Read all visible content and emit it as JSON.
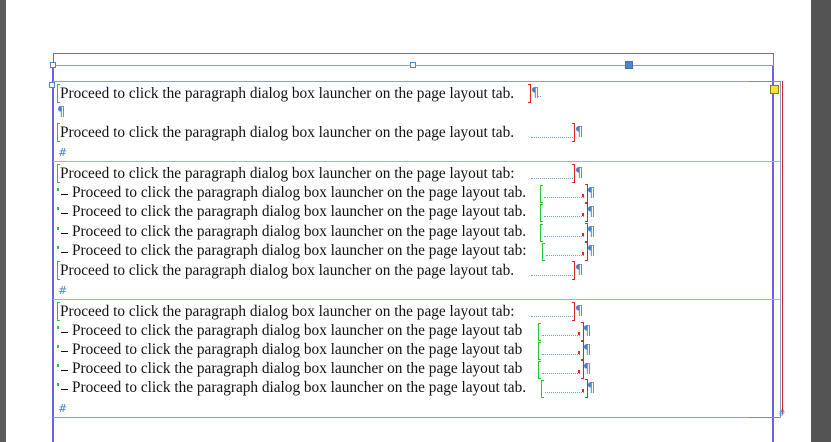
{
  "document": {
    "cells": [
      {
        "paragraphs": [
          {
            "text": "Proceed to click the paragraph dialog box launcher on the page layout tab.",
            "end_mark": "¶"
          },
          {
            "text": "",
            "end_mark": "¶"
          },
          {
            "text": "Proceed to click the paragraph dialog box launcher on the page layout tab.",
            "end_mark": "¶"
          }
        ],
        "end_of_story_mark": "#"
      },
      {
        "paragraphs": [
          {
            "text": "Proceed to click the paragraph dialog box launcher on the page layout tab:",
            "end_mark": "¶"
          },
          {
            "text": "Proceed to click the paragraph dialog box launcher on the page layout tab.",
            "bullet": "-",
            "end_mark": "¶"
          },
          {
            "text": "Proceed to click the paragraph dialog box launcher on the page layout tab.",
            "bullet": "-",
            "end_mark": "¶"
          },
          {
            "text": "Proceed to click the paragraph dialog box launcher on the page layout tab.",
            "bullet": "-",
            "end_mark": "¶"
          },
          {
            "text": "Proceed to click the paragraph dialog box launcher on the page layout tab:",
            "bullet": "-",
            "end_mark": "¶"
          },
          {
            "text": "Proceed to click the paragraph dialog box launcher on the page layout tab.",
            "end_mark": "¶"
          }
        ],
        "end_of_story_mark": "#"
      },
      {
        "paragraphs": [
          {
            "text": "Proceed to click the paragraph dialog box launcher on the page layout tab:",
            "end_mark": "¶"
          },
          {
            "text": "Proceed to click the paragraph dialog box launcher on the page layout tab",
            "bullet": "-",
            "end_mark": "¶"
          },
          {
            "text": "Proceed to click the paragraph dialog box launcher on the page layout tab",
            "bullet": "-",
            "end_mark": "¶"
          },
          {
            "text": "Proceed to click the paragraph dialog box launcher on the page layout tab",
            "bullet": "-",
            "end_mark": "¶"
          },
          {
            "text": "Proceed to click the paragraph dialog box launcher on the page layout tab.",
            "bullet": "-",
            "end_mark": "¶"
          }
        ],
        "end_of_story_mark": "#"
      }
    ]
  },
  "colors": {
    "pasteboard": "#5c5c5c",
    "page": "#ffffff",
    "margin_guide": "#c040d0",
    "column_guide": "#6a5ff0",
    "frame_edge": "#7aa5d8",
    "selection_handle": "#4f86c9",
    "out_port": "#f2e23a",
    "paragraph_bracket_open": "#27c43a",
    "paragraph_bracket_close": "#e02222",
    "hidden_characters": "#4a7fd0"
  },
  "icons": {
    "selection_handles": "square-handle",
    "text_frame_out_port": "out-port-icon",
    "paragraph_mark": "pilcrow-icon",
    "end_of_story": "end-of-story-icon"
  }
}
